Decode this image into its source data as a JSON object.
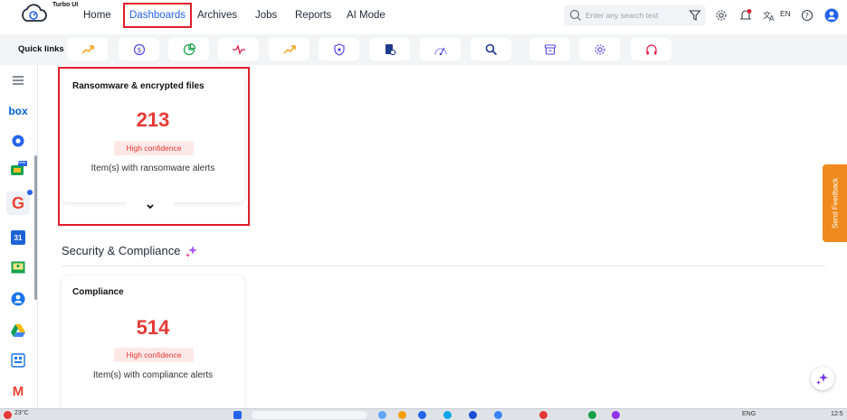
{
  "app": {
    "logo_text": "Turbo UI"
  },
  "nav": {
    "items": [
      {
        "label": "Home"
      },
      {
        "label": "Dashboards"
      },
      {
        "label": "Archives"
      },
      {
        "label": "Jobs"
      },
      {
        "label": "Reports"
      },
      {
        "label": "AI Mode"
      }
    ],
    "active": "Dashboards"
  },
  "search": {
    "placeholder": "Enter any search text",
    "value": ""
  },
  "header_actions": {
    "language": "EN"
  },
  "quicklinks": {
    "label": "Quick links",
    "icons": [
      "trend-up-icon",
      "dollar-icon",
      "pie-chart-icon",
      "pulse-icon",
      "trend-up-icon",
      "shield-icon",
      "document-search-icon",
      "radar-icon",
      "search-icon",
      "archive-icon",
      "gear-icon",
      "headphones-icon"
    ]
  },
  "sidebar": {
    "items": [
      {
        "icon": "hamburger-icon"
      },
      {
        "icon": "box-logo-icon",
        "label": "box"
      },
      {
        "icon": "onedrive-icon"
      },
      {
        "icon": "google-chat-icon",
        "badge": "Beta"
      },
      {
        "icon": "google-icon",
        "label": "G"
      },
      {
        "icon": "google-calendar-icon",
        "label": "31"
      },
      {
        "icon": "google-classroom-icon"
      },
      {
        "icon": "contacts-icon"
      },
      {
        "icon": "google-drive-icon"
      },
      {
        "icon": "sites-icon"
      },
      {
        "icon": "gmail-icon",
        "label": "M"
      }
    ]
  },
  "cards": [
    {
      "title": "Ransomware & encrypted files",
      "value": "213",
      "confidence": "High confidence",
      "description": "Item(s) with ransomware alerts"
    },
    {
      "title": "Compliance",
      "value": "514",
      "confidence": "High confidence",
      "description": "Item(s) with compliance alerts"
    }
  ],
  "section": {
    "title": "Security & Compliance"
  },
  "feedback": {
    "label": "Send Feedback"
  },
  "colors": {
    "accent": "#2563eb",
    "alert": "#e53935",
    "highlight": "#e11d2a",
    "feedback": "#f08a1c"
  },
  "taskbar": {
    "weather": "23°C",
    "lang": "ENG",
    "time": "12:5"
  }
}
